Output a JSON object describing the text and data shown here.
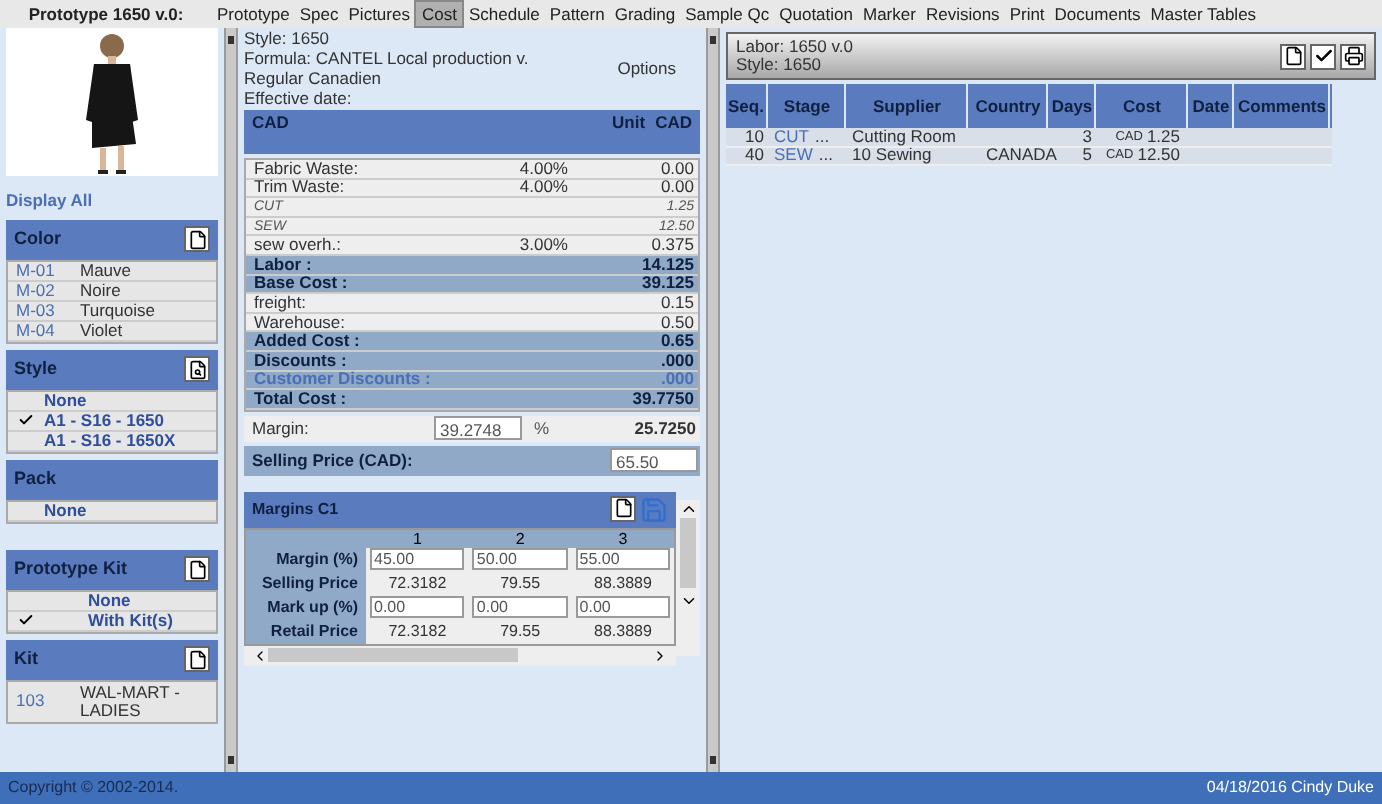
{
  "menu": {
    "title": "Prototype 1650 v.0:",
    "items": [
      {
        "label": "Prototype",
        "selected": false
      },
      {
        "label": "Spec",
        "selected": false
      },
      {
        "label": "Pictures",
        "selected": false
      },
      {
        "label": "Cost",
        "selected": true
      },
      {
        "label": "Schedule",
        "selected": false
      },
      {
        "label": "Pattern",
        "selected": false
      },
      {
        "label": "Grading",
        "selected": false
      },
      {
        "label": "Sample Qc",
        "selected": false
      },
      {
        "label": "Quotation",
        "selected": false
      },
      {
        "label": "Marker",
        "selected": false
      },
      {
        "label": "Revisions",
        "selected": false
      },
      {
        "label": "Print",
        "selected": false
      },
      {
        "label": "Documents",
        "selected": false
      },
      {
        "label": "Master Tables",
        "selected": false
      }
    ]
  },
  "left": {
    "display_all": "Display All",
    "color": {
      "title": "Color",
      "rows": [
        {
          "code": "M-01",
          "name": "Mauve"
        },
        {
          "code": "M-02",
          "name": "Noire"
        },
        {
          "code": "M-03",
          "name": "Turquoise"
        },
        {
          "code": "M-04",
          "name": "Violet"
        }
      ]
    },
    "style": {
      "title": "Style",
      "rows": [
        {
          "label": "None",
          "checked": false
        },
        {
          "label": "A1 - S16 - 1650",
          "checked": true
        },
        {
          "label": "A1 - S16 - 1650X",
          "checked": false
        }
      ]
    },
    "pack": {
      "title": "Pack",
      "rows": [
        {
          "label": "None",
          "checked": false
        }
      ]
    },
    "prototype_kit": {
      "title": "Prototype Kit",
      "rows": [
        {
          "label": "None",
          "checked": false
        },
        {
          "label": "With Kit(s)",
          "checked": true
        }
      ]
    },
    "kit": {
      "title": "Kit",
      "rows": [
        {
          "code": "103",
          "name": "WAL-MART - LADIES"
        }
      ]
    }
  },
  "cost": {
    "style": "Style: 1650",
    "formula": "Formula: CANTEL Local production v. Regular Canadien",
    "options": "Options",
    "effective_date": "Effective date:",
    "header": {
      "currency": "CAD",
      "unit": "Unit",
      "cad": "CAD"
    },
    "rows": [
      {
        "kind": "plain",
        "label": "Fabric Waste:",
        "pct": "4.00%",
        "value": "0.00"
      },
      {
        "kind": "plain",
        "label": "Trim Waste:",
        "pct": "4.00%",
        "value": "0.00"
      },
      {
        "kind": "italic",
        "label": "CUT",
        "value": "1.25"
      },
      {
        "kind": "italic",
        "label": "SEW",
        "value": "12.50"
      },
      {
        "kind": "plain",
        "label": "sew overh.:",
        "pct": "3.00%",
        "value": "0.375"
      },
      {
        "kind": "total",
        "label": "Labor :",
        "value": "14.125"
      },
      {
        "kind": "total",
        "label": "Base Cost :",
        "value": "39.125"
      },
      {
        "kind": "plain",
        "label": "freight:",
        "value": "0.15"
      },
      {
        "kind": "plain",
        "label": "Warehouse:",
        "value": "0.50"
      },
      {
        "kind": "total",
        "label": "Added Cost :",
        "value": "0.65"
      },
      {
        "kind": "total",
        "label": "Discounts :",
        "value": ".000"
      },
      {
        "kind": "customer",
        "label": "Customer Discounts :",
        "value": ".000"
      },
      {
        "kind": "total",
        "label": "Total Cost :",
        "value": "39.7750"
      }
    ],
    "margin": {
      "label": "Margin:",
      "value": "39.2748",
      "unit": "%",
      "result": "25.7250"
    },
    "selling_price": {
      "label": "Selling Price (CAD):",
      "value": "65.50"
    }
  },
  "margins": {
    "title": "Margins C1",
    "columns": [
      "1",
      "2",
      "3"
    ],
    "rows": [
      {
        "kind": "input",
        "label": "Margin (%)",
        "values": [
          "45.00",
          "50.00",
          "55.00"
        ]
      },
      {
        "kind": "text",
        "label": "Selling Price",
        "values": [
          "72.3182",
          "79.55",
          "88.3889"
        ]
      },
      {
        "kind": "input",
        "label": "Mark up (%)",
        "values": [
          "0.00",
          "0.00",
          "0.00"
        ]
      },
      {
        "kind": "text",
        "label": "Retail Price",
        "values": [
          "72.3182",
          "79.55",
          "88.3889"
        ]
      }
    ]
  },
  "labor": {
    "title": "Labor: 1650 v.0",
    "style": "Style: 1650",
    "columns": [
      "Seq.",
      "Stage",
      "Supplier",
      "Country",
      "Days",
      "Cost",
      "Date",
      "Comments"
    ],
    "rows": [
      {
        "seq": "10",
        "stage": "CUT",
        "more": "...",
        "supplier": "Cutting Room",
        "country": "",
        "days": "3",
        "currency": "CAD",
        "cost": "1.25"
      },
      {
        "seq": "40",
        "stage": "SEW",
        "more": "...",
        "supplier": "10 Sewing",
        "country": "CANADA",
        "days": "5",
        "currency": "CAD",
        "cost": "12.50"
      }
    ]
  },
  "status_bar": {
    "copyright": "Copyright © 2002-2014.",
    "user": "04/18/2016 Cindy Duke"
  }
}
